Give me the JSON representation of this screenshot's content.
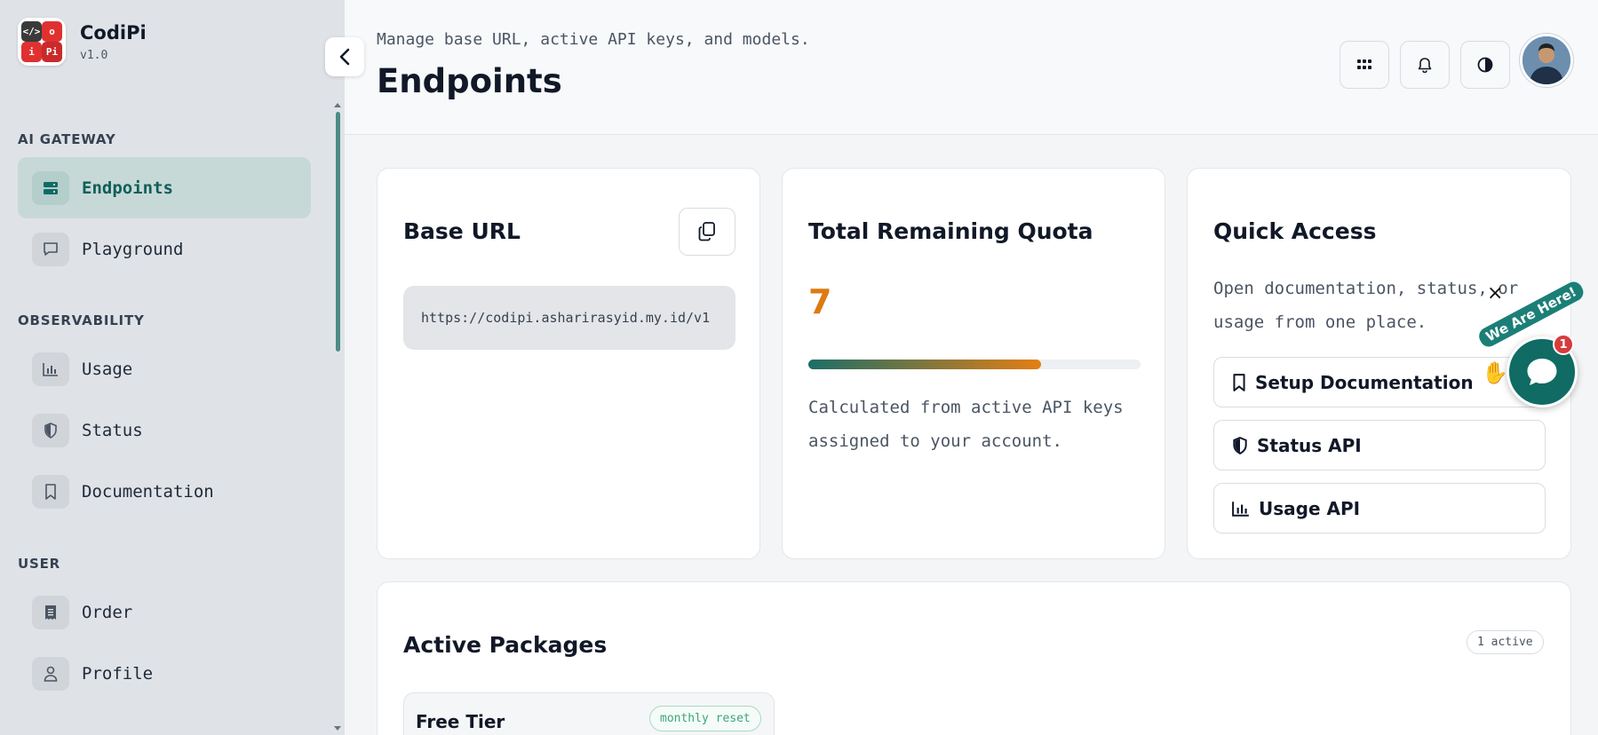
{
  "app": {
    "name": "CodiPi",
    "version": "v1.0"
  },
  "sidebar": {
    "sections": [
      {
        "label": "AI GATEWAY",
        "items": [
          {
            "label": "Endpoints",
            "icon": "server-icon",
            "active": true
          },
          {
            "label": "Playground",
            "icon": "chat-bubble-icon"
          }
        ]
      },
      {
        "label": "OBSERVABILITY",
        "items": [
          {
            "label": "Usage",
            "icon": "bar-chart-icon"
          },
          {
            "label": "Status",
            "icon": "shield-icon"
          },
          {
            "label": "Documentation",
            "icon": "bookmark-icon"
          }
        ]
      },
      {
        "label": "USER",
        "items": [
          {
            "label": "Order",
            "icon": "receipt-icon"
          },
          {
            "label": "Profile",
            "icon": "user-icon"
          }
        ]
      }
    ]
  },
  "header": {
    "subtitle": "Manage base URL, active API keys, and models.",
    "title": "Endpoints",
    "buttons": [
      "grid-icon",
      "bell-icon",
      "contrast-icon"
    ]
  },
  "base_url": {
    "title": "Base URL",
    "url": "https://codipi.asharirasyid.my.id/v1"
  },
  "quota": {
    "title": "Total Remaining Quota",
    "value": "7",
    "progress_fraction": 0.7,
    "description": "Calculated from active API keys assigned to your account."
  },
  "quick_access": {
    "title": "Quick Access",
    "description": "Open documentation, status, or usage from one place.",
    "links": [
      {
        "label": "Setup Documentation",
        "icon": "bookmark-icon"
      },
      {
        "label": "Status API",
        "icon": "shield-icon"
      },
      {
        "label": "Usage API",
        "icon": "bar-chart-icon"
      }
    ]
  },
  "packages": {
    "title": "Active Packages",
    "count_badge": "1 active",
    "items": [
      {
        "name": "Free Tier",
        "badge": "monthly reset"
      }
    ]
  },
  "chat_widget": {
    "tag": "We Are Here!",
    "unread": "1",
    "close": "×"
  },
  "colors": {
    "accent": "#0f6b64",
    "quota": "#dd7a12",
    "sidebar_bg": "#dfe3e7"
  }
}
